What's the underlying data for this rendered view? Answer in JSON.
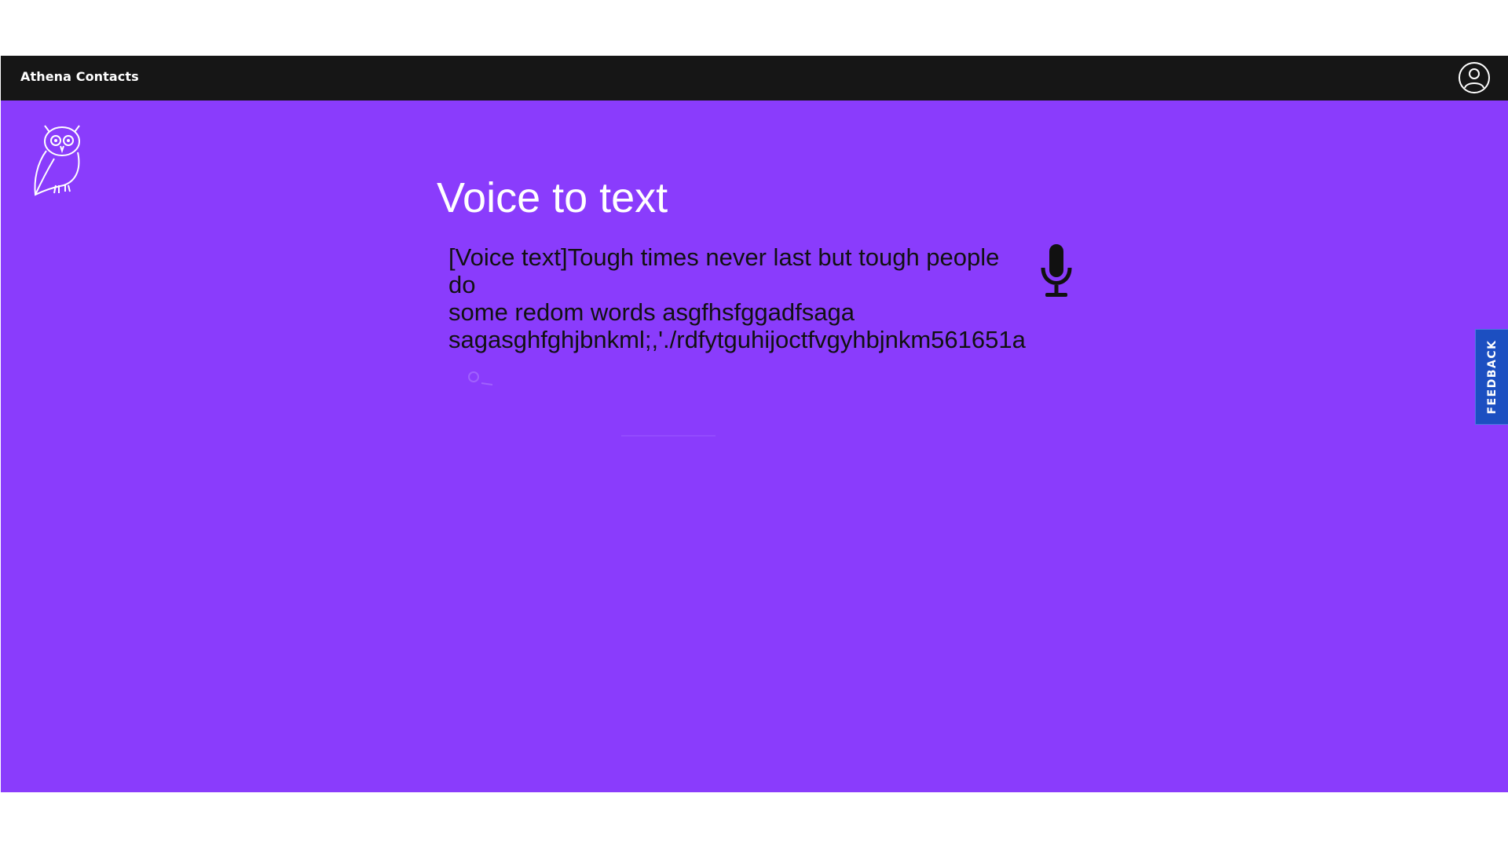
{
  "header": {
    "app_title": "Athena Contacts",
    "user_icon": "user-circle-icon"
  },
  "logo": {
    "icon": "owl-logo-icon"
  },
  "main": {
    "title": "Voice to text",
    "transcript_lines": [
      "[Voice text]Tough times never last but tough people",
      "do",
      "some redom words asgfhsfggadfsaga",
      "sagasghfghjbnkml;,'./rdfytguhijoctfvgyhbjnkm561651a"
    ],
    "mic_icon": "microphone-icon"
  },
  "feedback": {
    "label": "FEEDBACK"
  },
  "colors": {
    "background": "#8a3cfc",
    "topbar": "#161616",
    "feedback_tab": "#1c4fc1",
    "title_text": "#ffffff",
    "transcript_text": "#111111"
  }
}
